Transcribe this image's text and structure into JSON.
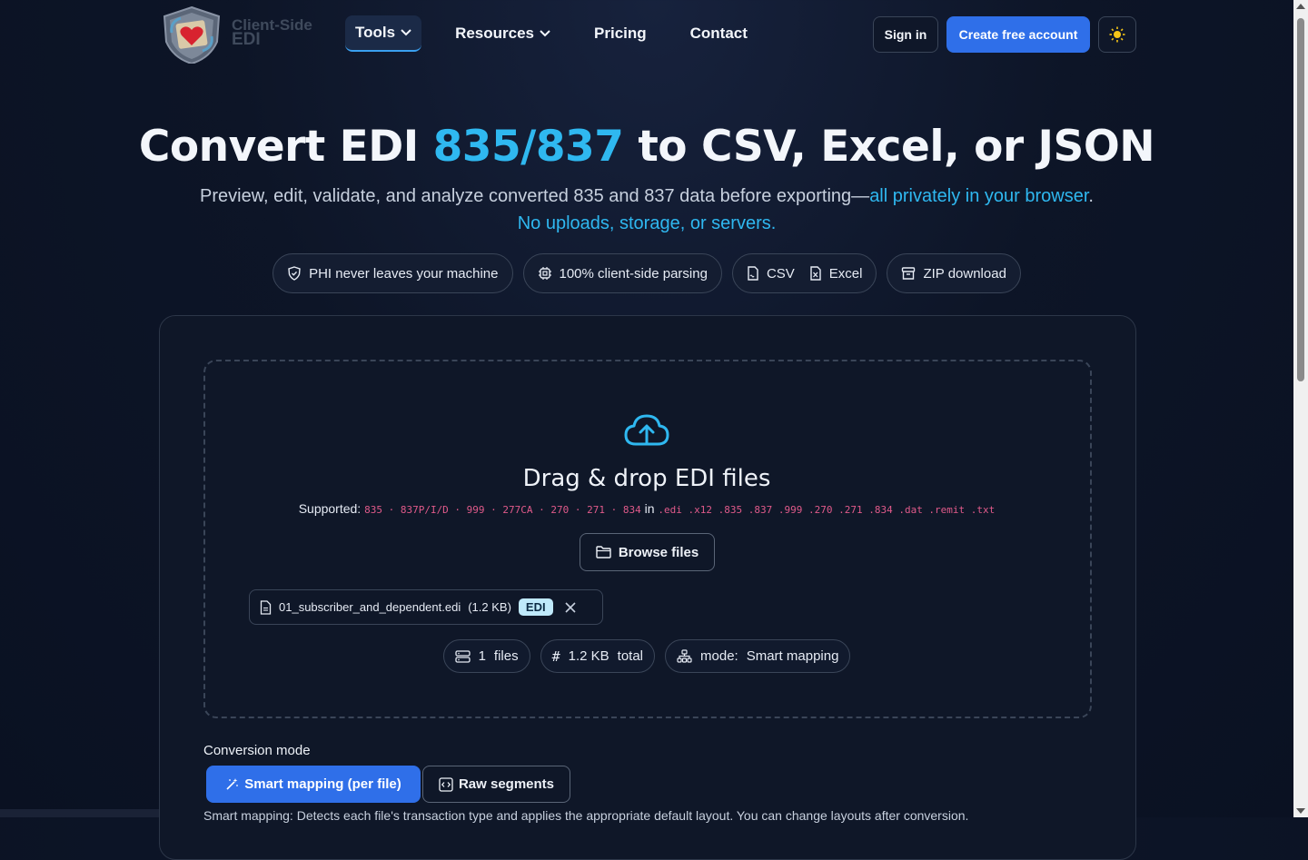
{
  "brand": {
    "line1": "Client-Side",
    "line2": "EDI"
  },
  "nav": {
    "tools": "Tools",
    "resources": "Resources",
    "pricing": "Pricing",
    "contact": "Contact",
    "sign_in": "Sign in",
    "create_account": "Create free account"
  },
  "hero": {
    "title_pre": "Convert EDI ",
    "title_accent": "835/837",
    "title_post": " to CSV, Excel, or JSON",
    "sub_plain": "Preview, edit, validate, and analyze converted 835 and 837 data before exporting—",
    "sub_accent": "all privately in your browser",
    "sub_period": ".",
    "sub_line2": "No uploads, storage, or servers."
  },
  "badges": {
    "phi": "PHI never leaves your machine",
    "client": "100% client-side parsing",
    "csv": "CSV",
    "excel": "Excel",
    "zip": "ZIP download"
  },
  "dropzone": {
    "title": "Drag & drop EDI files",
    "supported_label": "Supported:",
    "types": "835 · 837P/I/D · 999 · 277CA · 270 · 271 · 834",
    "in_word": "in",
    "extensions": ".edi .x12 .835 .837 .999 .270 .271 .834 .dat .remit .txt",
    "browse": "Browse files"
  },
  "file": {
    "name": "01_subscriber_and_dependent.edi",
    "size": "(1.2 KB)",
    "tag": "EDI"
  },
  "stats": {
    "files_count": "1",
    "files_label": "files",
    "total_size": "1.2 KB",
    "total_label": "total",
    "mode_label": "mode:",
    "mode_value": "Smart mapping"
  },
  "conversion": {
    "label": "Conversion mode",
    "smart": "Smart mapping (per file)",
    "raw": "Raw segments",
    "description": "Smart mapping: Detects each file's transaction type and applies the appropriate default layout. You can change layouts after conversion."
  },
  "colors": {
    "accent": "#2fb8f0",
    "primary": "#2f6fe9",
    "code": "#e05a8a"
  }
}
